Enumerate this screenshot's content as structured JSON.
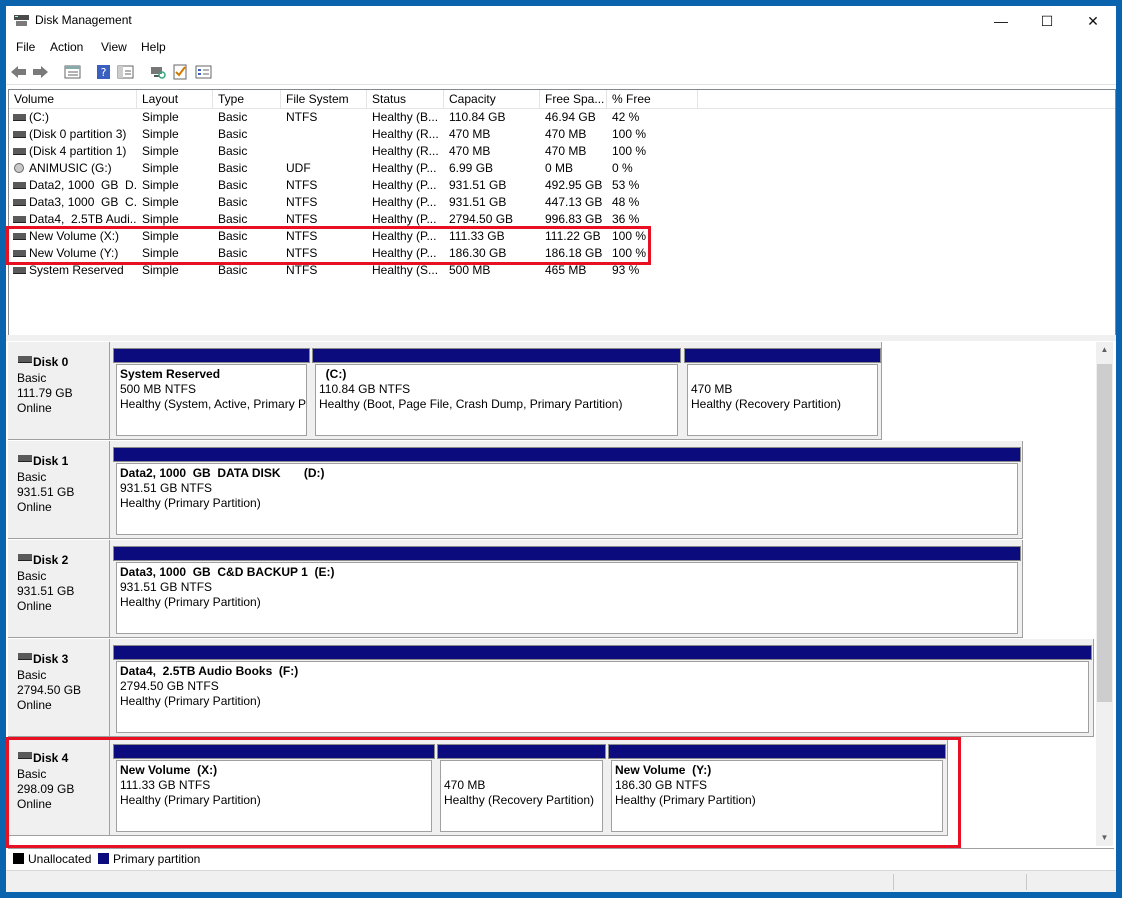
{
  "window": {
    "title": "Disk Management",
    "minimize_glyph": "—",
    "maximize_glyph": "☐",
    "close_glyph": "✕"
  },
  "menu": [
    "File",
    "Action",
    "View",
    "Help"
  ],
  "toolbar_icons": [
    "back-arrow-icon",
    "forward-arrow-icon",
    "list-view-icon",
    "help-icon",
    "console-tree-icon",
    "connect-icon",
    "check-icon",
    "properties-icon"
  ],
  "volume_columns": [
    "Volume",
    "Layout",
    "Type",
    "File System",
    "Status",
    "Capacity",
    "Free Spa...",
    "% Free"
  ],
  "volumes": [
    {
      "volume": "(C:)",
      "layout": "Simple",
      "type": "Basic",
      "fs": "NTFS",
      "status": "Healthy (B...",
      "capacity": "110.84 GB",
      "free": "46.94 GB",
      "pct": "42 %",
      "icon": "disk"
    },
    {
      "volume": "(Disk 0 partition 3)",
      "layout": "Simple",
      "type": "Basic",
      "fs": "",
      "status": "Healthy (R...",
      "capacity": "470 MB",
      "free": "470 MB",
      "pct": "100 %",
      "icon": "disk"
    },
    {
      "volume": "(Disk 4 partition 1)",
      "layout": "Simple",
      "type": "Basic",
      "fs": "",
      "status": "Healthy (R...",
      "capacity": "470 MB",
      "free": "470 MB",
      "pct": "100 %",
      "icon": "disk"
    },
    {
      "volume": "ANIMUSIC (G:)",
      "layout": "Simple",
      "type": "Basic",
      "fs": "UDF",
      "status": "Healthy (P...",
      "capacity": "6.99 GB",
      "free": "0 MB",
      "pct": "0 %",
      "icon": "cd"
    },
    {
      "volume": "Data2, 1000  GB  D...",
      "layout": "Simple",
      "type": "Basic",
      "fs": "NTFS",
      "status": "Healthy (P...",
      "capacity": "931.51 GB",
      "free": "492.95 GB",
      "pct": "53 %",
      "icon": "disk"
    },
    {
      "volume": "Data3, 1000  GB  C...",
      "layout": "Simple",
      "type": "Basic",
      "fs": "NTFS",
      "status": "Healthy (P...",
      "capacity": "931.51 GB",
      "free": "447.13 GB",
      "pct": "48 %",
      "icon": "disk"
    },
    {
      "volume": "Data4,  2.5TB Audi...",
      "layout": "Simple",
      "type": "Basic",
      "fs": "NTFS",
      "status": "Healthy (P...",
      "capacity": "2794.50 GB",
      "free": "996.83 GB",
      "pct": "36 %",
      "icon": "disk"
    },
    {
      "volume": "New Volume (X:)",
      "layout": "Simple",
      "type": "Basic",
      "fs": "NTFS",
      "status": "Healthy (P...",
      "capacity": "111.33 GB",
      "free": "111.22 GB",
      "pct": "100 %",
      "icon": "disk"
    },
    {
      "volume": "New Volume (Y:)",
      "layout": "Simple",
      "type": "Basic",
      "fs": "NTFS",
      "status": "Healthy (P...",
      "capacity": "186.30 GB",
      "free": "186.18 GB",
      "pct": "100 %",
      "icon": "disk"
    },
    {
      "volume": "System Reserved",
      "layout": "Simple",
      "type": "Basic",
      "fs": "NTFS",
      "status": "Healthy (S...",
      "capacity": "500 MB",
      "free": "465 MB",
      "pct": "93 %",
      "icon": "disk"
    }
  ],
  "disks": [
    {
      "name": "Disk 0",
      "kind": "Basic",
      "size": "111.79 GB",
      "state": "Online",
      "partitions": [
        {
          "title": "System Reserved",
          "detail": "500 MB NTFS",
          "status": "Healthy (System, Active, Primary P"
        },
        {
          "title": "  (C:)",
          "detail": "110.84 GB NTFS",
          "status": "Healthy (Boot, Page File, Crash Dump, Primary Partition)"
        },
        {
          "title": "",
          "detail": "470 MB",
          "status": "Healthy (Recovery Partition)"
        }
      ]
    },
    {
      "name": "Disk 1",
      "kind": "Basic",
      "size": "931.51 GB",
      "state": "Online",
      "partitions": [
        {
          "title": "Data2, 1000  GB  DATA DISK       (D:)",
          "detail": "931.51 GB NTFS",
          "status": "Healthy (Primary Partition)"
        }
      ]
    },
    {
      "name": "Disk 2",
      "kind": "Basic",
      "size": "931.51 GB",
      "state": "Online",
      "partitions": [
        {
          "title": "Data3, 1000  GB  C&D BACKUP 1  (E:)",
          "detail": "931.51 GB NTFS",
          "status": "Healthy (Primary Partition)"
        }
      ]
    },
    {
      "name": "Disk 3",
      "kind": "Basic",
      "size": "2794.50 GB",
      "state": "Online",
      "partitions": [
        {
          "title": "Data4,  2.5TB Audio Books  (F:)",
          "detail": "2794.50 GB NTFS",
          "status": "Healthy (Primary Partition)"
        }
      ]
    },
    {
      "name": "Disk 4",
      "kind": "Basic",
      "size": "298.09 GB",
      "state": "Online",
      "partitions": [
        {
          "title": "New Volume  (X:)",
          "detail": "111.33 GB NTFS",
          "status": "Healthy (Primary Partition)"
        },
        {
          "title": "",
          "detail": "470 MB",
          "status": "Healthy (Recovery Partition)"
        },
        {
          "title": "New Volume  (Y:)",
          "detail": "186.30 GB NTFS",
          "status": "Healthy (Primary Partition)"
        }
      ]
    }
  ],
  "legend": [
    {
      "label": "Unallocated",
      "color": "#000000"
    },
    {
      "label": "Primary partition",
      "color": "#0b0b7d"
    }
  ],
  "colors": {
    "partition_bar": "#0b0b7d",
    "highlight": "#e81123",
    "desktop": "#0a64ad"
  }
}
